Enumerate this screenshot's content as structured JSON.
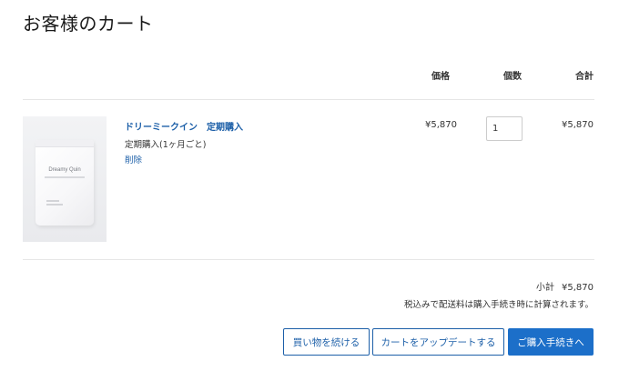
{
  "page": {
    "title": "お客様のカート"
  },
  "table_headers": {
    "price": "価格",
    "quantity": "個数",
    "total": "合計"
  },
  "cart_items": [
    {
      "name": "ドリーミークイン　定期購入",
      "variant": "定期購入(1ヶ月ごと)",
      "remove_label": "削除",
      "price": "¥5,870",
      "quantity": "1",
      "line_total": "¥5,870",
      "image": {
        "brand_text": "Dreamy Quin"
      }
    }
  ],
  "summary": {
    "subtotal_label": "小計",
    "subtotal_value": "¥5,870",
    "tax_note": "税込みで配送料は購入手続き時に計算されます。"
  },
  "buttons": {
    "continue_shopping": "買い物を続ける",
    "update_cart": "カートをアップデートする",
    "checkout": "ご購入手続きへ"
  },
  "colors": {
    "link": "#1c5fa8",
    "primary_button": "#1c6fc9",
    "divider": "#e6e6e6"
  }
}
